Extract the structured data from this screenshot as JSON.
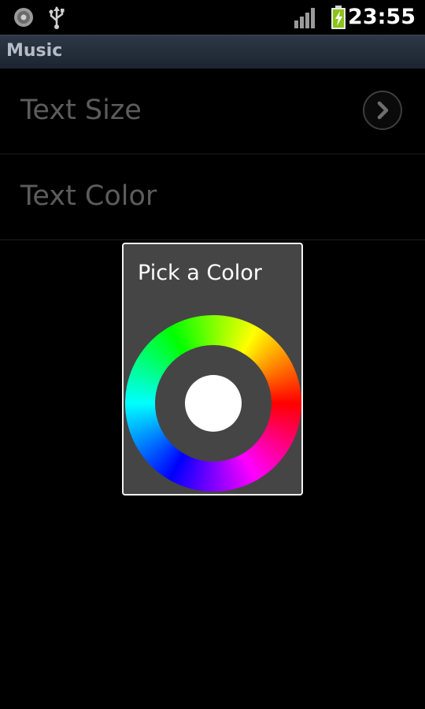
{
  "status_bar": {
    "time": "23:55",
    "icons": [
      "disc-icon",
      "usb-icon",
      "signal-icon",
      "battery-charging-icon"
    ]
  },
  "app": {
    "title": "Music"
  },
  "preferences": {
    "items": [
      {
        "label": "Text Size",
        "icon": "chevron-right-icon"
      },
      {
        "label": "Text Color"
      }
    ]
  },
  "dialog": {
    "title": "Pick a Color",
    "selected_color": "#ffffff",
    "wheel_colors": [
      "#ff0000",
      "#ff00ff",
      "#0000ff",
      "#00ffff",
      "#00ff00",
      "#ffff00"
    ]
  },
  "colors": {
    "background": "#000000",
    "title_bar": "#253040",
    "dialog_background": "#454545",
    "label_gray": "#5c5c5c"
  }
}
